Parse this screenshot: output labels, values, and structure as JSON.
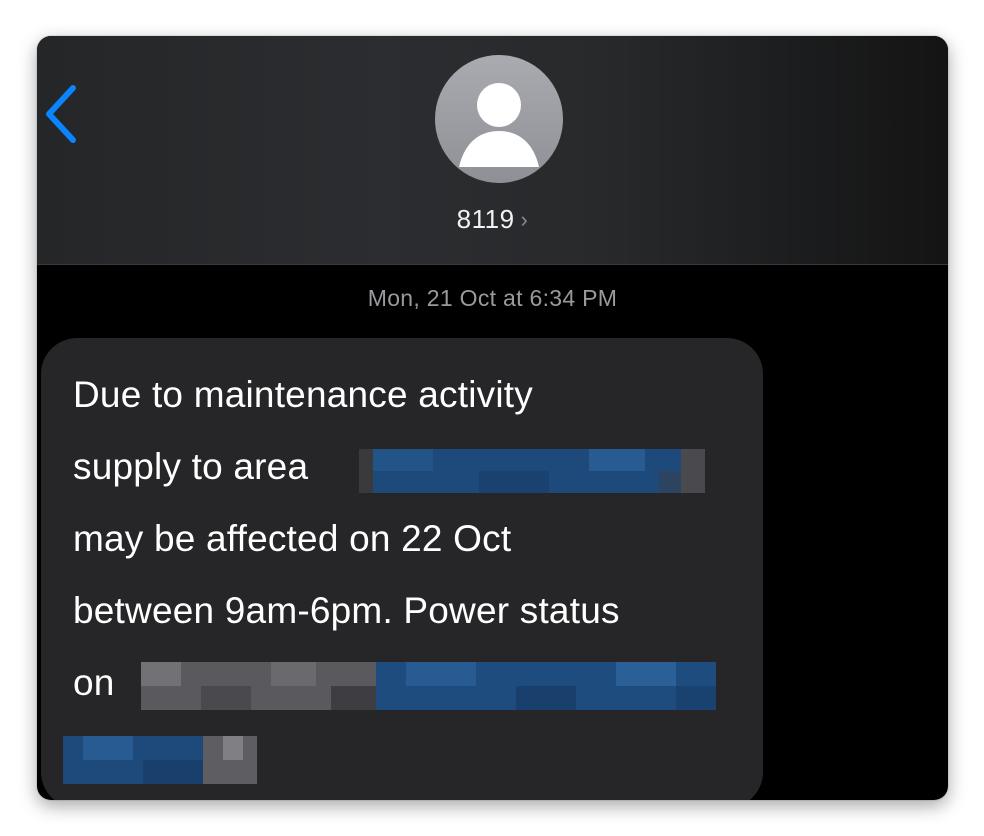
{
  "header": {
    "back_icon": "chevron-left-icon",
    "avatar_icon": "person-placeholder-icon",
    "contact_name": "8119",
    "contact_chevron": "›"
  },
  "conversation": {
    "timestamp": "Mon, 21 Oct at 6:34 PM",
    "message": {
      "line1": "Due to maintenance activity",
      "line2": "supply to area",
      "line3": "may be affected on 22 Oct",
      "line4": "between 9am-6pm. Power status",
      "line5": "on"
    }
  },
  "colors": {
    "accent_blue": "#0a84ff",
    "background": "#000000",
    "bubble": "#262628",
    "text": "#ffffff",
    "secondary_text": "#9a9a9e"
  }
}
